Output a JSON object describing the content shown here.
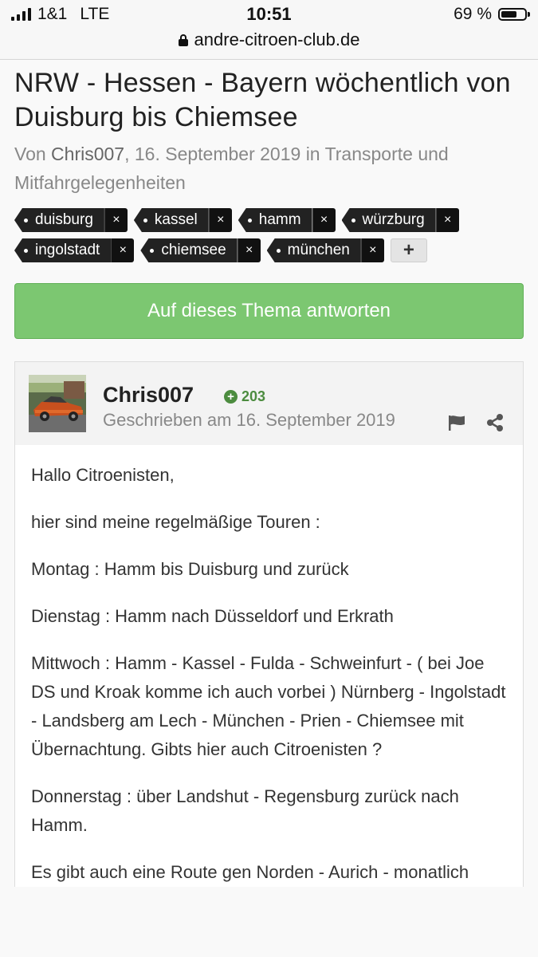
{
  "status_bar": {
    "carrier": "1&1",
    "network": "LTE",
    "time": "10:51",
    "battery_percent": "69 %",
    "battery_level": 0.69
  },
  "browser": {
    "url": "andre-citroen-club.de"
  },
  "topic": {
    "title": "NRW - Hessen - Bayern wöchentlich von Duisburg bis Chiemsee",
    "meta_prefix": "Von",
    "author": "Chris007",
    "meta_date": ", 16. September 2019 in Transporte und Mitfahrgelegenheiten"
  },
  "tags": [
    {
      "label": "duisburg",
      "remove": "×"
    },
    {
      "label": "kassel",
      "remove": "×"
    },
    {
      "label": "hamm",
      "remove": "×"
    },
    {
      "label": "würzburg",
      "remove": "×"
    },
    {
      "label": "ingolstadt",
      "remove": "×"
    },
    {
      "label": "chiemsee",
      "remove": "×"
    },
    {
      "label": "münchen",
      "remove": "×"
    }
  ],
  "add_tag_label": "+",
  "reply_button": "Auf dieses Thema antworten",
  "post": {
    "username": "Chris007",
    "reputation": "203",
    "rep_icon": "+",
    "date": "Geschrieben am 16. September 2019",
    "paragraphs": [
      "Hallo Citroenisten,",
      "hier sind meine regelmäßige Touren :",
      "Montag : Hamm bis Duisburg und zurück",
      "Dienstag : Hamm nach Düsseldorf und Erkrath",
      "Mittwoch : Hamm - Kassel - Fulda - Schweinfurt - ( bei Joe DS und Kroak komme ich auch vorbei ) Nürnberg - Ingolstadt - Landsberg am Lech - München - Prien - Chiemsee mit Übernachtung. Gibts hier auch Citroenisten ?",
      "Donnerstag : über Landshut - Regensburg zurück nach Hamm.",
      "Es gibt auch eine Route gen Norden - Aurich - monatlich"
    ]
  },
  "colors": {
    "reply_green": "#7cc771",
    "tag_dark": "#222222",
    "rep_green": "#4c8c3f"
  }
}
